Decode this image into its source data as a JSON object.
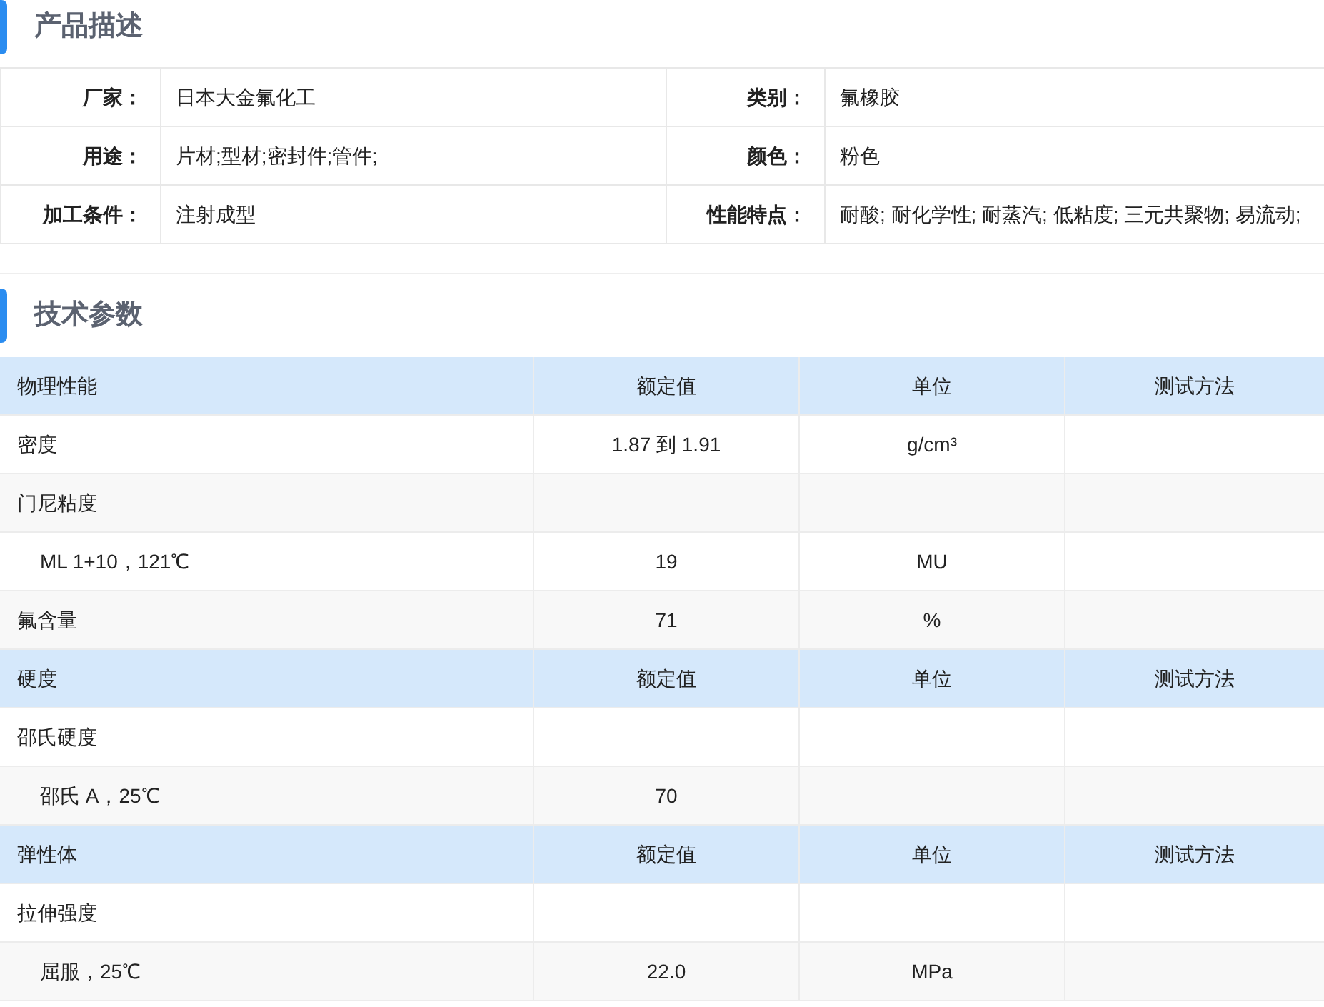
{
  "description": {
    "title": "产品描述",
    "rows": [
      [
        {
          "label": "厂家：",
          "value": "日本大金氟化工"
        },
        {
          "label": "类别：",
          "value": "氟橡胶"
        }
      ],
      [
        {
          "label": "用途：",
          "value": "片材;型材;密封件;管件;"
        },
        {
          "label": "颜色：",
          "value": "粉色"
        }
      ],
      [
        {
          "label": "加工条件：",
          "value": "注射成型"
        },
        {
          "label": "性能特点：",
          "value": "耐酸; 耐化学性; 耐蒸汽; 低粘度; 三元共聚物; 易流动;"
        }
      ]
    ]
  },
  "specs": {
    "title": "技术参数",
    "rows": [
      {
        "kind": "header",
        "cells": [
          "物理性能",
          "额定值",
          "单位",
          "测试方法"
        ]
      },
      {
        "kind": "item",
        "cells": [
          "密度",
          "1.87 到 1.91",
          "g/cm³",
          ""
        ]
      },
      {
        "kind": "item",
        "cells": [
          "门尼粘度",
          "",
          "",
          ""
        ]
      },
      {
        "kind": "sub",
        "cells": [
          "ML 1+10，121℃",
          "19",
          "MU",
          ""
        ]
      },
      {
        "kind": "item",
        "cells": [
          "氟含量",
          "71",
          "%",
          ""
        ]
      },
      {
        "kind": "header",
        "cells": [
          "硬度",
          "额定值",
          "单位",
          "测试方法"
        ]
      },
      {
        "kind": "item",
        "cells": [
          "邵氏硬度",
          "",
          "",
          ""
        ]
      },
      {
        "kind": "sub",
        "cells": [
          "邵氏 A，25℃",
          "70",
          "",
          ""
        ]
      },
      {
        "kind": "header",
        "cells": [
          "弹性体",
          "额定值",
          "单位",
          "测试方法"
        ]
      },
      {
        "kind": "item",
        "cells": [
          "拉伸强度",
          "",
          "",
          ""
        ]
      },
      {
        "kind": "sub",
        "cells": [
          "屈服，25℃",
          "22.0",
          "MPa",
          ""
        ]
      }
    ]
  }
}
